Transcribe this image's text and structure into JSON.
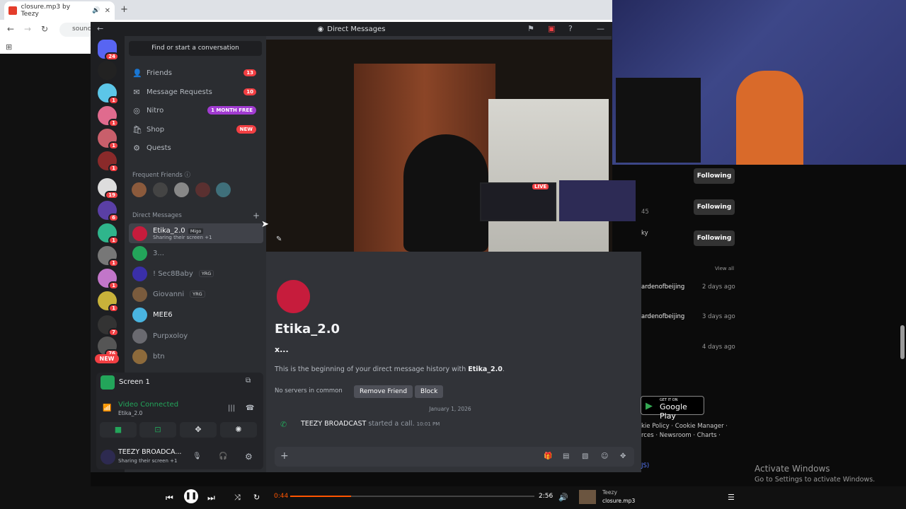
{
  "browser": {
    "tab_title": "closure.mp3 by Teezy",
    "url_fragment": "sounc"
  },
  "discord": {
    "window_title": "Direct Messages",
    "search_placeholder": "Find or start a conversation",
    "guild_badges": [
      "24",
      "",
      "1",
      "1",
      "1",
      "1",
      "19",
      "6",
      "1",
      "1",
      "1",
      "1",
      "1",
      "7",
      "76"
    ],
    "guild_new": "NEW",
    "nav": [
      {
        "label": "Friends",
        "badge": "13",
        "icon": "friends-icon"
      },
      {
        "label": "Message Requests",
        "badge": "10",
        "icon": "mail-icon"
      },
      {
        "label": "Nitro",
        "badge": "1 MONTH FREE",
        "icon": "nitro-icon"
      },
      {
        "label": "Shop",
        "badge": "NEW",
        "icon": "shop-icon"
      },
      {
        "label": "Quests",
        "badge": "",
        "icon": "quests-icon"
      }
    ],
    "frequent_friends_label": "Frequent Friends",
    "dm_section_label": "Direct Messages",
    "dms": [
      {
        "name": "Etika_2.0",
        "tag": "Migo",
        "sub": "Sharing their screen +1",
        "color": "#c61c3c"
      },
      {
        "name": "3...",
        "tag": "",
        "sub": "",
        "color": "#23a55a"
      },
      {
        "name": "! Sec8Baby",
        "tag": "YRG",
        "sub": "",
        "color": "#3a2fa8"
      },
      {
        "name": "Giovanni",
        "tag": "YRG",
        "sub": "",
        "color": "#7a5b3d"
      },
      {
        "name": "MEE6",
        "tag": "",
        "sub": "",
        "color": "#49b4e0"
      },
      {
        "name": "Purpxoloy",
        "tag": "",
        "sub": "",
        "color": "#6a6a70"
      },
      {
        "name": "btn",
        "tag": "",
        "sub": "",
        "color": "#8d6a3b"
      }
    ],
    "voice": {
      "screen_label": "Screen 1",
      "status": "Video Connected",
      "channel": "Etika_2.0"
    },
    "user": {
      "name": "TEEZY BROADCA...",
      "status": "Sharing their screen +1"
    },
    "stream": {
      "live_badge": "LIVE"
    },
    "profile": {
      "display_name": "Etika_2.0",
      "username": "x...",
      "intro_prefix": "This is the beginning of your direct message history with ",
      "intro_name": "Etika_2.0",
      "intro_suffix": ".",
      "mutual": "No servers in common",
      "remove_friend": "Remove Friend",
      "block": "Block"
    },
    "messages": {
      "date": "January 1, 2026",
      "caller": "TEEZY BROADCAST",
      "action": " started a call.",
      "time": "10:01 PM"
    }
  },
  "soundcloud": {
    "following_label": "Following",
    "view_all": "View all",
    "likes": [
      {
        "user": "ardenofbeijing",
        "ago": "2 days ago"
      },
      {
        "user": "ardenofbeijing",
        "ago": "3 days ago"
      },
      {
        "user": "",
        "ago": "4 days ago"
      }
    ],
    "fragments": [
      "45",
      "ky"
    ],
    "google_play": "Google Play",
    "google_play_top": "GET IT ON",
    "footer_links_1": "kie Policy · Cookie Manager ·",
    "footer_links_2": "rces · Newsroom · Charts ·",
    "footer_links_3": "JS)",
    "player": {
      "elapsed": "0:44",
      "duration": "2:56",
      "progress": 0.25,
      "artist": "Teezy",
      "track": "closure.mp3"
    }
  },
  "windows": {
    "activate_title": "Activate Windows",
    "activate_sub": "Go to Settings to activate Windows."
  }
}
